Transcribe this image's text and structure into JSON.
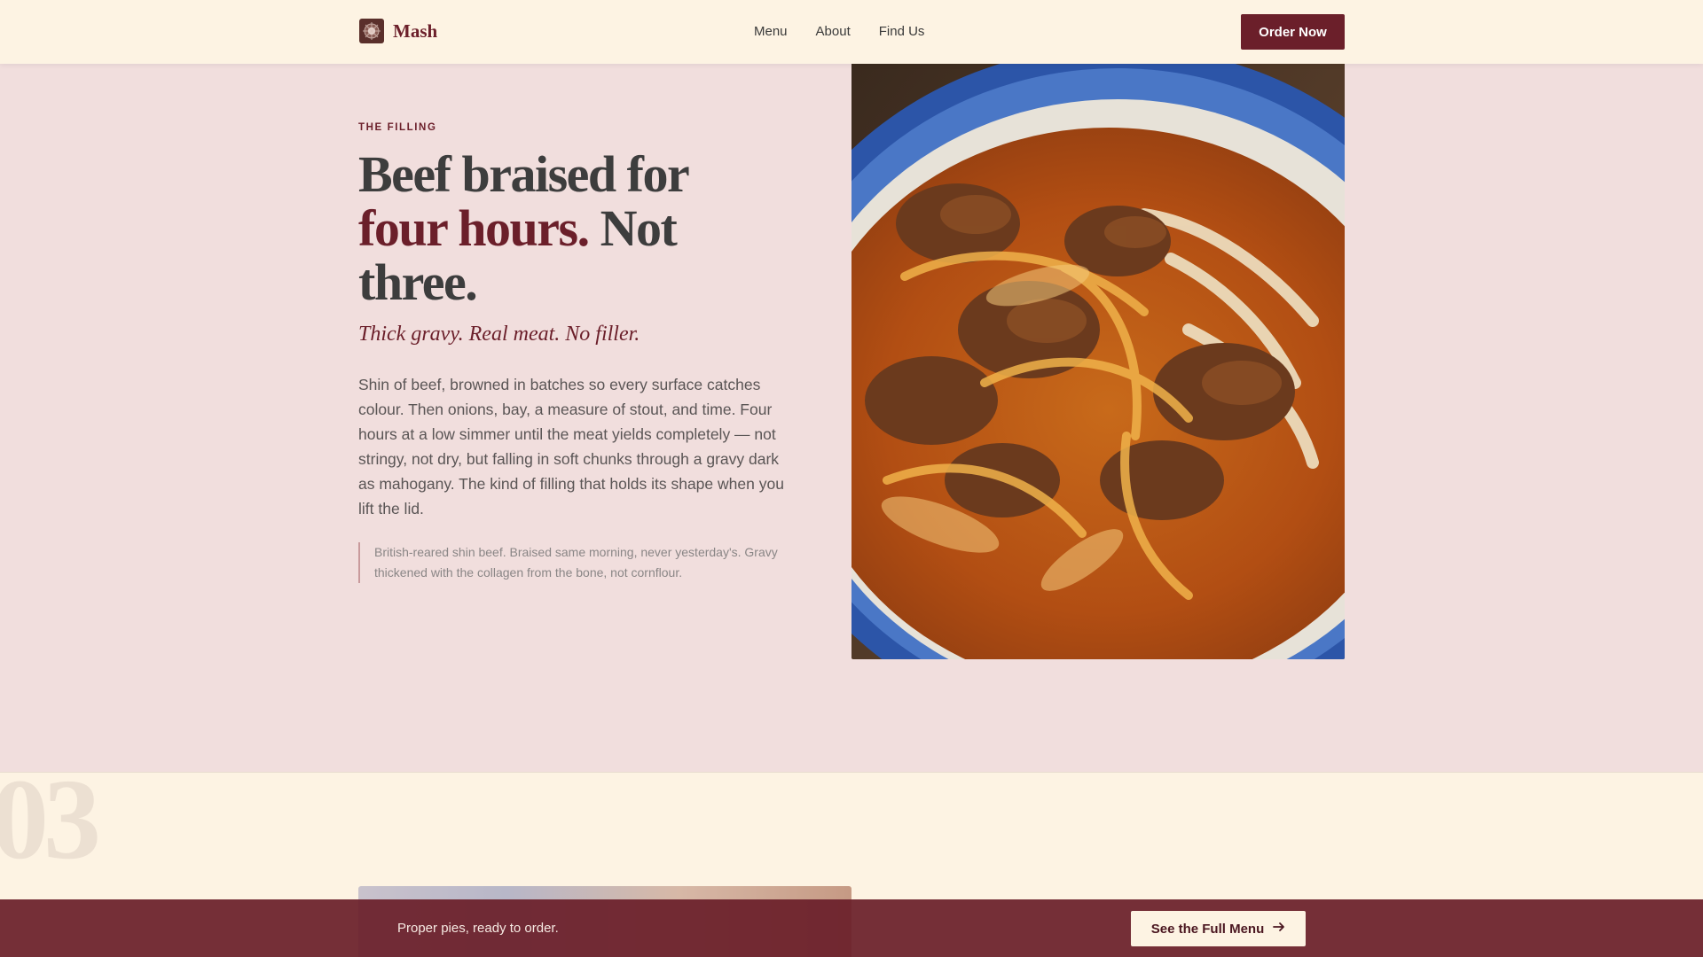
{
  "brand": {
    "name": "Mash",
    "logo_icon": "pie-logo-icon"
  },
  "nav": {
    "items": [
      {
        "label": "Menu"
      },
      {
        "label": "About"
      },
      {
        "label": "Find Us"
      }
    ]
  },
  "header": {
    "cta_label": "Order Now"
  },
  "hero": {
    "eyebrow": "THE FILLING",
    "headline_part1": "Beef braised for ",
    "headline_accent": "four hours.",
    "headline_part2": " Not three.",
    "subhead": "Thick gravy. Real meat. No filler.",
    "body": "Shin of beef, browned in batches so every surface catches colour. Then onions, bay, a measure of stout, and time. Four hours at a low simmer until the meat yields completely — not stringy, not dry, but falling in soft chunks through a gravy dark as mahogany. The kind of filling that holds its shape when you lift the lid.",
    "note": "British-reared shin beef. Braised same morning, never yesterday's. Gravy thickened with the collagen from the bone, not cornflour.",
    "image_subject": "braised beef with onions in blue-rimmed bowl"
  },
  "section2": {
    "number": "03"
  },
  "bottom_bar": {
    "text": "Proper pies, ready to order.",
    "cta_label": "See the Full Menu",
    "cta_icon": "arrow-right-icon"
  },
  "colors": {
    "brand": "#6b1f2a",
    "header_bg": "#fdf3e3",
    "hero_bg": "#f1dedd",
    "text": "#3d3d3d"
  }
}
